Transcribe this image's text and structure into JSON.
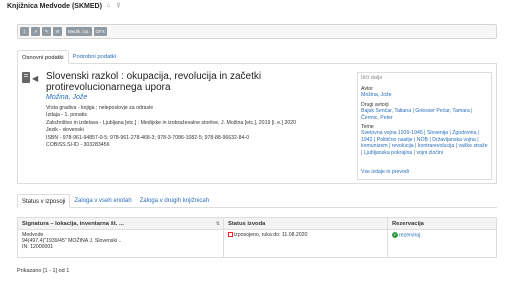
{
  "header": {
    "title": "Knjižnica Medvode (SKMED)",
    "icons": [
      "home-icon",
      "location-icon"
    ]
  },
  "toolbar": {
    "buttons": [
      "",
      "",
      "",
      "",
      "Medik. izp.",
      "GFX"
    ],
    "icons": [
      "download-icon",
      "share-icon",
      "edit-icon",
      "email-icon"
    ]
  },
  "tabs": {
    "basic": "Osnovni podatki",
    "detail": "Podrobni podatki"
  },
  "record": {
    "title": "Slovenski razkol : okupacija, revolucija in začetki protirevolucionarnega upora",
    "author": "Možina, Jože",
    "details": [
      {
        "label": "Vrsta gradiva",
        "value": " - knjiga ; neleposlovje za odrasle"
      },
      {
        "label": "Izdaja",
        "value": " - 1. ponatis"
      },
      {
        "label": "Založništvo in izdelava",
        "value": " - Ljubljana [etc.] : Medijske in izobraževalne storitve, J. Možina [etc.], 2019 [i. e.] 2020"
      },
      {
        "label": "Jezik",
        "value": " - slovenski"
      },
      {
        "label": "ISBN",
        "value": " - 978-961-94857-0-5; 978-961-278-468-3; 978-3-7086-1082-5; 978-88-96632-84-0"
      },
      {
        "label": "COBISS.SI-ID",
        "value": " - 303283456"
      }
    ]
  },
  "side": {
    "header": "Išči dalje",
    "author_label": "Avtor",
    "author": "Možina, Jože",
    "other_authors_label": "Drugi avtorji",
    "other_authors": "Bajuk Senčar, Tatiana | Griesser Pečar, Tamara | Čermic, Peter",
    "topic_label": "Teme",
    "topics": "Svetovna vojna 1939-1945 | Slovenija | Zgodovina | 1942 | Politično nasilje | NOB | Državljanska vojna | komunizem | revolucija | kontrarevolucija | vaške straže | Ljubljanska pokrajina | vojni zločini",
    "more_link": "Vse izdaje in prevodi"
  },
  "availability": {
    "tabs": [
      "Status v izposoji",
      "Zaloga v vseh enotah",
      "Zaloga v drugih knjižnicah"
    ],
    "columns": [
      "Signatura – lokacija, inventarna št. ...",
      "Status izvoda",
      "Rezervacija"
    ],
    "rows": [
      {
        "loc1": "Medvode",
        "loc2": "94(497.4)\"1939/45\" MOŽINA J. Slovenski ..",
        "loc3": "IN: 12000001",
        "status": "izposojeno, ruka do: 11.08.2020",
        "reservation": "rezerviraj"
      }
    ]
  },
  "paging": "Prikazano [1 - 1] od 1"
}
